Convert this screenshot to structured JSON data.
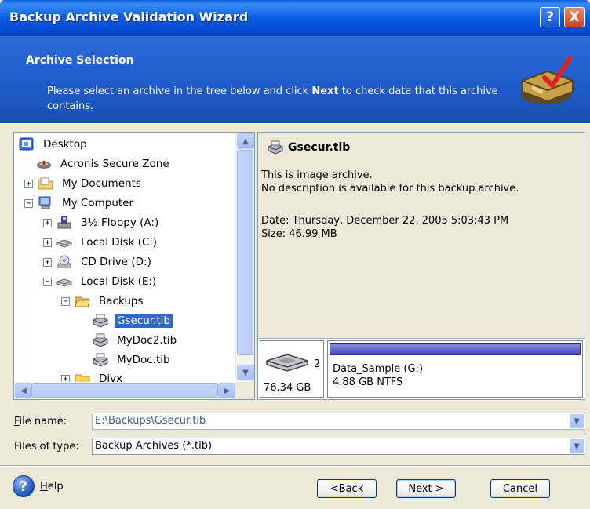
{
  "window": {
    "title": "Backup Archive Validation Wizard",
    "help_glyph": "?",
    "close_glyph": "X"
  },
  "header": {
    "title": "Archive Selection",
    "desc_before": "Please select an archive in the tree below and click ",
    "desc_bold": "Next",
    "desc_after": " to check data that this archive contains."
  },
  "tree": {
    "items": [
      {
        "label": "Desktop",
        "icon": "desktop-icon"
      },
      {
        "label": "Acronis Secure Zone",
        "icon": "secure-zone-icon"
      },
      {
        "label": "My Documents",
        "icon": "folder-icon",
        "expander": "+"
      },
      {
        "label": "My Computer",
        "icon": "computer-icon",
        "expander": "−"
      },
      {
        "label": "3½ Floppy (A:)",
        "icon": "floppy-icon",
        "expander": "+"
      },
      {
        "label": "Local Disk (C:)",
        "icon": "disk-icon",
        "expander": "+"
      },
      {
        "label": "CD Drive (D:)",
        "icon": "cd-icon",
        "expander": "+"
      },
      {
        "label": "Local Disk (E:)",
        "icon": "disk-icon",
        "expander": "−"
      },
      {
        "label": "Backups",
        "icon": "folder-open-icon",
        "expander": "−"
      },
      {
        "label": "Gsecur.tib",
        "icon": "archive-icon",
        "selected": true
      },
      {
        "label": "MyDoc2.tib",
        "icon": "archive-icon"
      },
      {
        "label": "MyDoc.tib",
        "icon": "archive-icon"
      },
      {
        "label": "Divx",
        "icon": "folder-icon",
        "expander": "+"
      }
    ]
  },
  "info": {
    "title": "Gsecur.tib",
    "line1": "This is image archive.",
    "line2": "No description is available for this backup archive.",
    "date": "Date: Thursday, December 22, 2005 5:03:43 PM",
    "size": "Size: 46.99 MB",
    "disk_number": "2",
    "disk_capacity": "76.34 GB",
    "partition_name": "Data_Sample (G:)",
    "partition_size": "4.88 GB  NTFS"
  },
  "form": {
    "file_name_label_u": "F",
    "file_name_label_rest": "ile name:",
    "file_name_value": "E:\\Backups\\Gsecur.tib",
    "file_type_label": "Files of type:",
    "file_type_value": "Backup Archives (*.tib)"
  },
  "buttons": {
    "help_u": "H",
    "help_rest": "elp",
    "back": "< ",
    "back_u": "B",
    "back_rest": "ack",
    "next_u": "N",
    "next_rest": "ext >",
    "cancel_u": "C",
    "cancel_rest": "ancel"
  }
}
